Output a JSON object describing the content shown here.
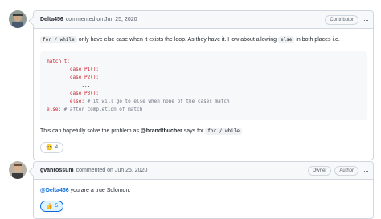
{
  "comments": [
    {
      "author": "Delta456",
      "timestamp": "commented on Jun 25, 2020",
      "badges": [
        "Contributor"
      ],
      "body": {
        "p1_before": "for / while",
        "p1_text1": " only have else case when it exists the loop. As they have it. How about allowing ",
        "p1_code2": "else",
        "p1_text2": " in both places i.e. :",
        "code_lines": [
          {
            "t": "kw",
            "v": "match t:"
          },
          {
            "t": "kw",
            "v": "        case P1():"
          },
          {
            "t": "kw",
            "v": "        case P2():"
          },
          {
            "t": "plain",
            "v": "            ..."
          },
          {
            "t": "kw",
            "v": "        case P3():"
          },
          {
            "t": "mixed",
            "v": "        else:",
            "c": " # it will go to else when none of the cases match"
          },
          {
            "t": "mixed",
            "v": "else:",
            "c": " # after completion of match"
          }
        ],
        "p2_text1": "This can hopefully solve the problem as ",
        "p2_mention": "@brandtbucher",
        "p2_text2": " says for ",
        "p2_code": "for / while",
        "p2_text3": " ."
      },
      "reaction": {
        "emoji": "😕",
        "count": "4",
        "active": false
      }
    },
    {
      "author": "gvanrossum",
      "timestamp": "commented on Jun 25, 2020",
      "badges": [
        "Owner",
        "Author"
      ],
      "body": {
        "mention": "@Delta456",
        "text": " you are a true Solomon."
      },
      "reaction": {
        "emoji": "👍",
        "count": "5",
        "active": true
      }
    }
  ],
  "icons": {
    "kebab": "kebab-menu-icon"
  }
}
